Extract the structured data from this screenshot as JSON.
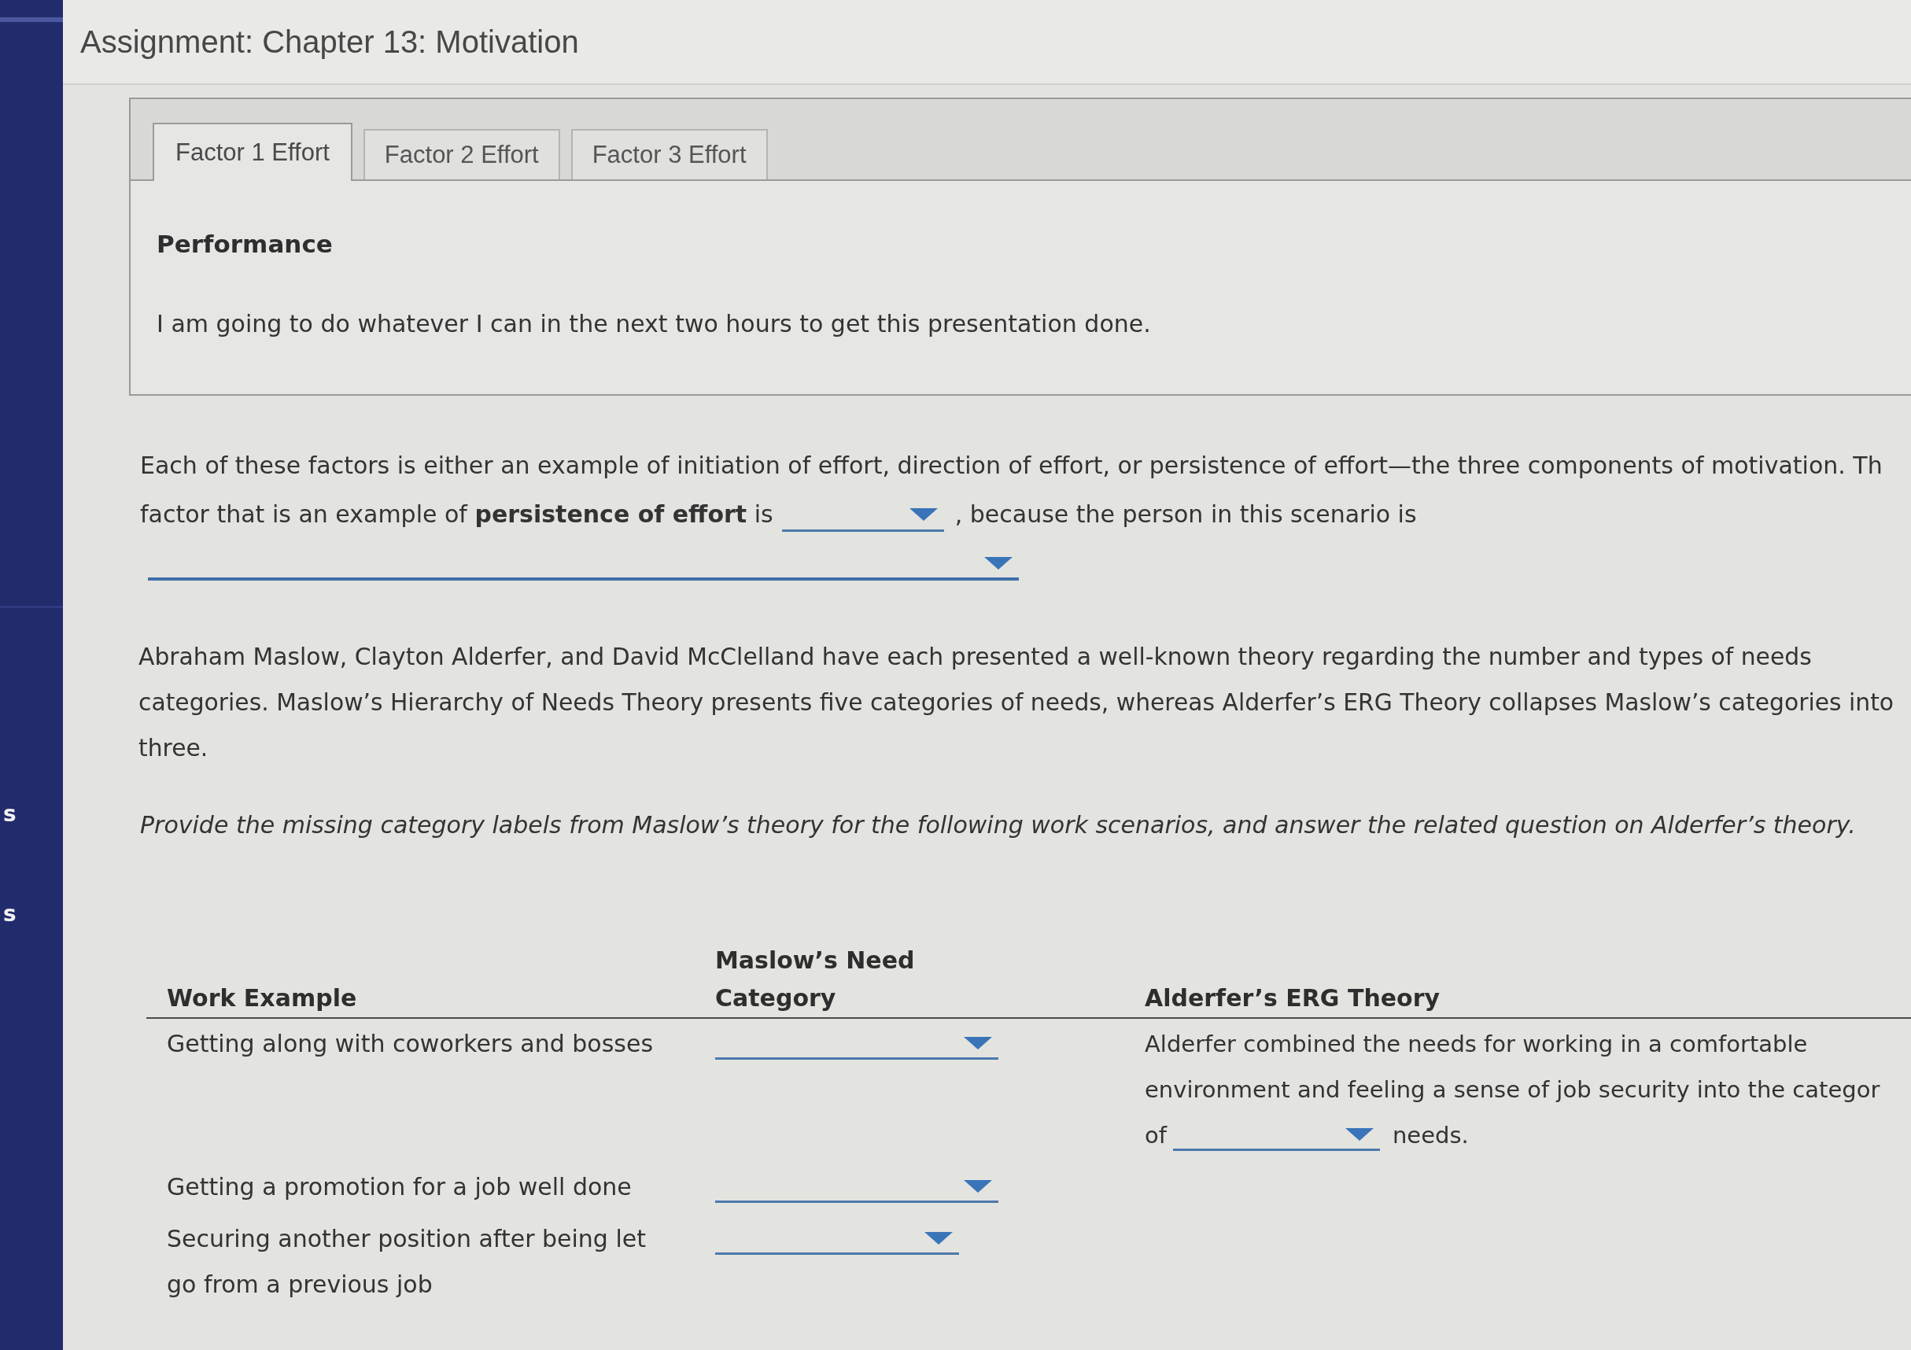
{
  "sidebar": {
    "items": [
      {
        "label": "s"
      },
      {
        "label": "s"
      }
    ]
  },
  "header": {
    "title": "Assignment: Chapter 13: Motivation"
  },
  "tabs": [
    {
      "label": "Factor 1 Effort",
      "selected": true
    },
    {
      "label": "Factor 2 Effort",
      "selected": false
    },
    {
      "label": "Factor 3 Effort",
      "selected": false
    }
  ],
  "tab_panel": {
    "heading": "Performance",
    "text": "I am going to do whatever I can in the next two hours to get this presentation done."
  },
  "question_1": {
    "first_line": "Each of these factors is either an example of initiation of effort, direction of effort, or persistence of effort—the three components of motivation. Th",
    "parts": [
      {
        "kind": "text",
        "text": "factor that is an example of **persistence of effort** is"
      },
      {
        "kind": "dropdown"
      },
      {
        "kind": "text",
        "text": ", because the person in this scenario is"
      },
      {
        "kind": "dropdown"
      }
    ]
  },
  "intro_paragraph": "Abraham Maslow, Clayton Alderfer, and David McClelland have each presented a well-known theory regarding the number and types of needs categories. Maslow’s Hierarchy of Needs Theory presents five categories of needs, whereas Alderfer’s ERG Theory collapses Maslow’s categories into three.",
  "instructions": "Provide the missing category labels from Maslow’s theory for the following work scenarios, and answer the related question on Alderfer’s theory.",
  "needs_table": {
    "columns": [
      "Work Example",
      "Maslow’s Need Category",
      "Alderfer’s ERG Theory"
    ],
    "rows": [
      {
        "work_example": "Getting along with coworkers and bosses",
        "maslow_need_category": {
          "kind": "dropdown"
        },
        "alderfers_erg_theory": {
          "text": "Alderfer combined the needs for working in a comfortable environment and feeling a sense of job security into the categor",
          "parts": [
            {
              "kind": "text",
              "text": "of"
            },
            {
              "kind": "dropdown"
            },
            {
              "kind": "text",
              "text": "needs."
            }
          ]
        }
      },
      {
        "work_example": "Getting a promotion for a job well done",
        "maslow_need_category": {
          "kind": "dropdown"
        }
      },
      {
        "work_example": "Securing another position after being let go from a previous job",
        "maslow_need_category": {
          "kind": "dropdown"
        }
      }
    ]
  }
}
